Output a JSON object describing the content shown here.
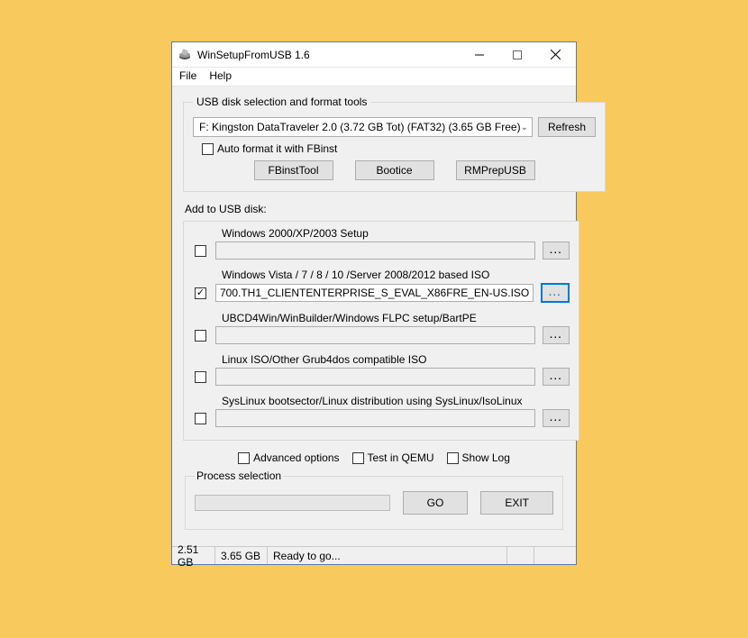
{
  "title": "WinSetupFromUSB 1.6",
  "menu": {
    "file": "File",
    "help": "Help"
  },
  "disk_group": {
    "legend": "USB disk selection and format tools",
    "selected": "F: Kingston DataTraveler 2.0 (3.72 GB Tot) (FAT32) (3.65 GB Free)",
    "refresh": "Refresh",
    "autoformat": "Auto format it with FBinst",
    "fbinst": "FBinstTool",
    "bootice": "Bootice",
    "rmprep": "RMPrepUSB"
  },
  "add_label": "Add to USB disk:",
  "items": {
    "win2000": {
      "label": "Windows 2000/XP/2003 Setup",
      "value": "",
      "checked": false
    },
    "vista": {
      "label": "Windows Vista / 7 / 8 / 10 /Server 2008/2012 based ISO",
      "value": "700.TH1_CLIENTENTERPRISE_S_EVAL_X86FRE_EN-US.ISO",
      "checked": true
    },
    "ubcd": {
      "label": "UBCD4Win/WinBuilder/Windows FLPC setup/BartPE",
      "value": "",
      "checked": false
    },
    "linux": {
      "label": "Linux ISO/Other Grub4dos compatible ISO",
      "value": "",
      "checked": false
    },
    "syslinux": {
      "label": "SysLinux bootsector/Linux distribution using SysLinux/IsoLinux",
      "value": "",
      "checked": false
    }
  },
  "adv": {
    "advanced": "Advanced options",
    "qemu": "Test in QEMU",
    "log": "Show Log"
  },
  "process": {
    "legend": "Process selection",
    "go": "GO",
    "exit": "EXIT"
  },
  "status": {
    "progress": "2.51 GB",
    "free": "3.65 GB",
    "msg": "Ready to go..."
  }
}
